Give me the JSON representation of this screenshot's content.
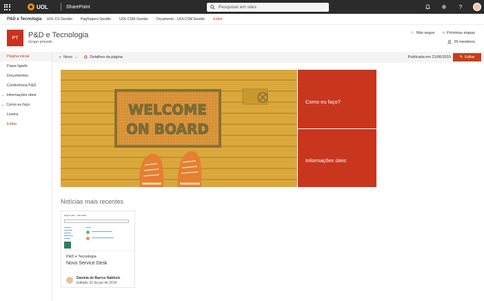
{
  "suite": {
    "app_name": "SharePoint",
    "logo_text": "UOL",
    "search_placeholder": "Pesquisar em sites",
    "icons": [
      "waffle-icon",
      "bell-icon",
      "gear-icon",
      "help-icon",
      "avatar"
    ]
  },
  "hub": {
    "title": "P&D e Tecnologia",
    "links": [
      "UOL CS Gestão",
      "PagSeguro Gestão",
      "UOL CSM Gestão",
      "Orçamento - UOLCSM Gestão"
    ],
    "edit_label": "Editar"
  },
  "site": {
    "logo_initials": "PT",
    "title": "P&D e Tecnologia",
    "subtitle": "Grupo privado",
    "follow_label": "Não segue",
    "next_steps_label": "Próximas etapas",
    "members_label": "26 membros"
  },
  "leftnav": {
    "items": [
      {
        "label": "Página inicial"
      },
      {
        "label": "Fique ligado"
      },
      {
        "label": "Documentos"
      },
      {
        "label": "Conferência P&D"
      },
      {
        "label": "Informações úteis"
      },
      {
        "label": "Como eu faço"
      },
      {
        "label": "Lixeira"
      },
      {
        "label": "Editar"
      }
    ]
  },
  "command": {
    "new_label": "Novo",
    "details_label": "Detalhes da página",
    "published_label": "Publicada em 21/06/2019",
    "edit_label": "Editar"
  },
  "hero": {
    "mat_text_line1": "WELCOME",
    "mat_text_line2": "ON BOARD",
    "tiles": [
      {
        "label": "Como eu faço?"
      },
      {
        "label": "Informações úteis"
      }
    ]
  },
  "news": {
    "section_title": "Notícias mais recentes",
    "thumb_title": "Help Center - UOLCSM",
    "site_name": "P&D e Tecnologia",
    "headline": "Novo Service Desk",
    "author": "Daniela de Barros Nabholz",
    "date": "Editado 21 de jun de 2019"
  },
  "colors": {
    "accent": "#c43e1c",
    "suitebar": "#2b2b2b",
    "tile": "#c9361e"
  }
}
